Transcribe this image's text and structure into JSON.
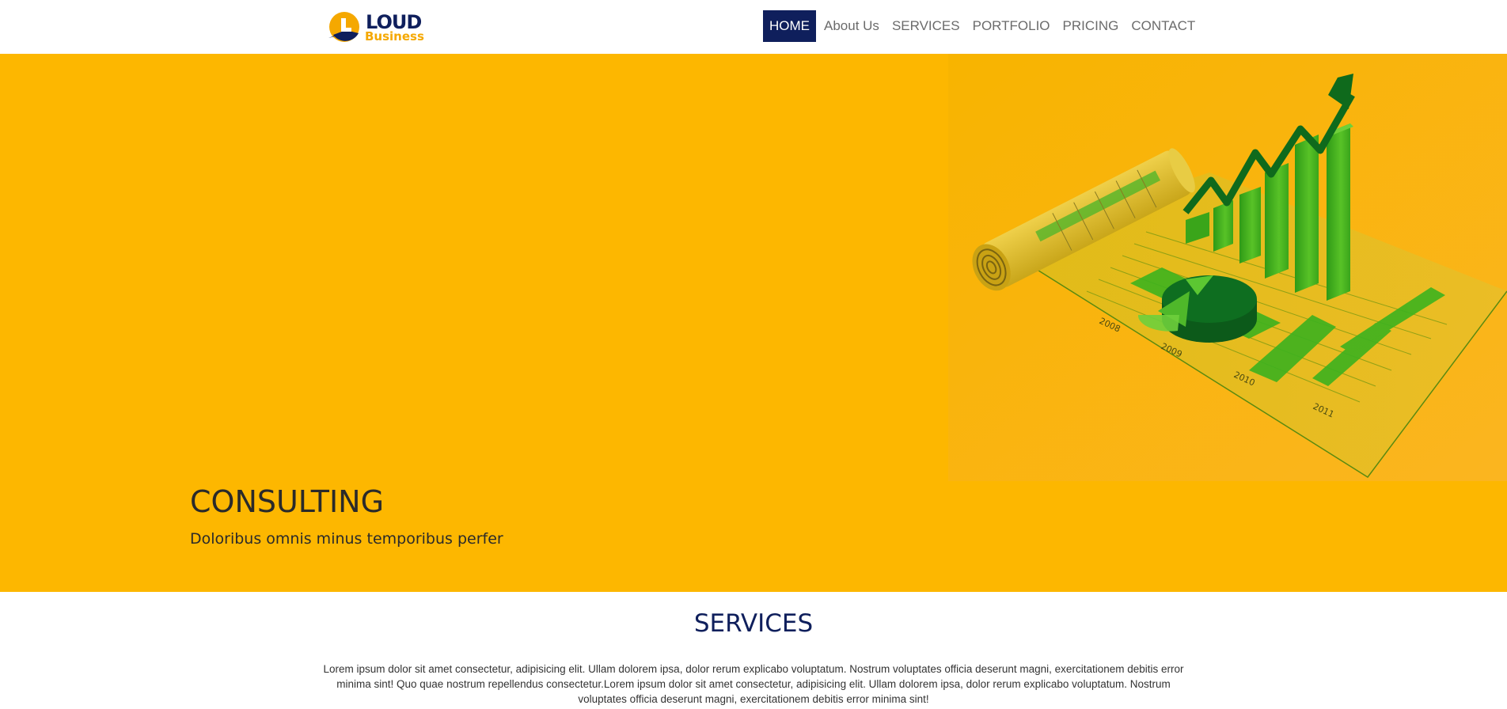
{
  "brand": {
    "name": "LOUD",
    "tagline": "Business",
    "colors": {
      "navy": "#0f1f5c",
      "orange": "#f5a800"
    }
  },
  "nav": {
    "items": [
      {
        "label": "HOME",
        "active": true
      },
      {
        "label": "About Us",
        "active": false
      },
      {
        "label": "SERVICES",
        "active": false
      },
      {
        "label": "PORTFOLIO",
        "active": false
      },
      {
        "label": "PRICING",
        "active": false
      },
      {
        "label": "CONTACT",
        "active": false
      }
    ]
  },
  "hero": {
    "title": "CONSULTING",
    "subtitle": "Doloribus omnis minus temporibus perfer",
    "background": "#fdb700",
    "image": {
      "icon": "growth-chart-illustration",
      "year_labels": [
        "2008",
        "2009",
        "2010",
        "2011"
      ]
    }
  },
  "services": {
    "title": "SERVICES",
    "text": "Lorem ipsum dolor sit amet consectetur, adipisicing elit. Ullam dolorem ipsa, dolor rerum explicabo voluptatum. Nostrum voluptates officia deserunt magni, exercitationem debitis error minima sint! Quo quae nostrum repellendus consectetur.Lorem ipsum dolor sit amet consectetur, adipisicing elit. Ullam dolorem ipsa, dolor rerum explicabo voluptatum. Nostrum voluptates officia deserunt magni, exercitationem debitis error minima sint!"
  }
}
